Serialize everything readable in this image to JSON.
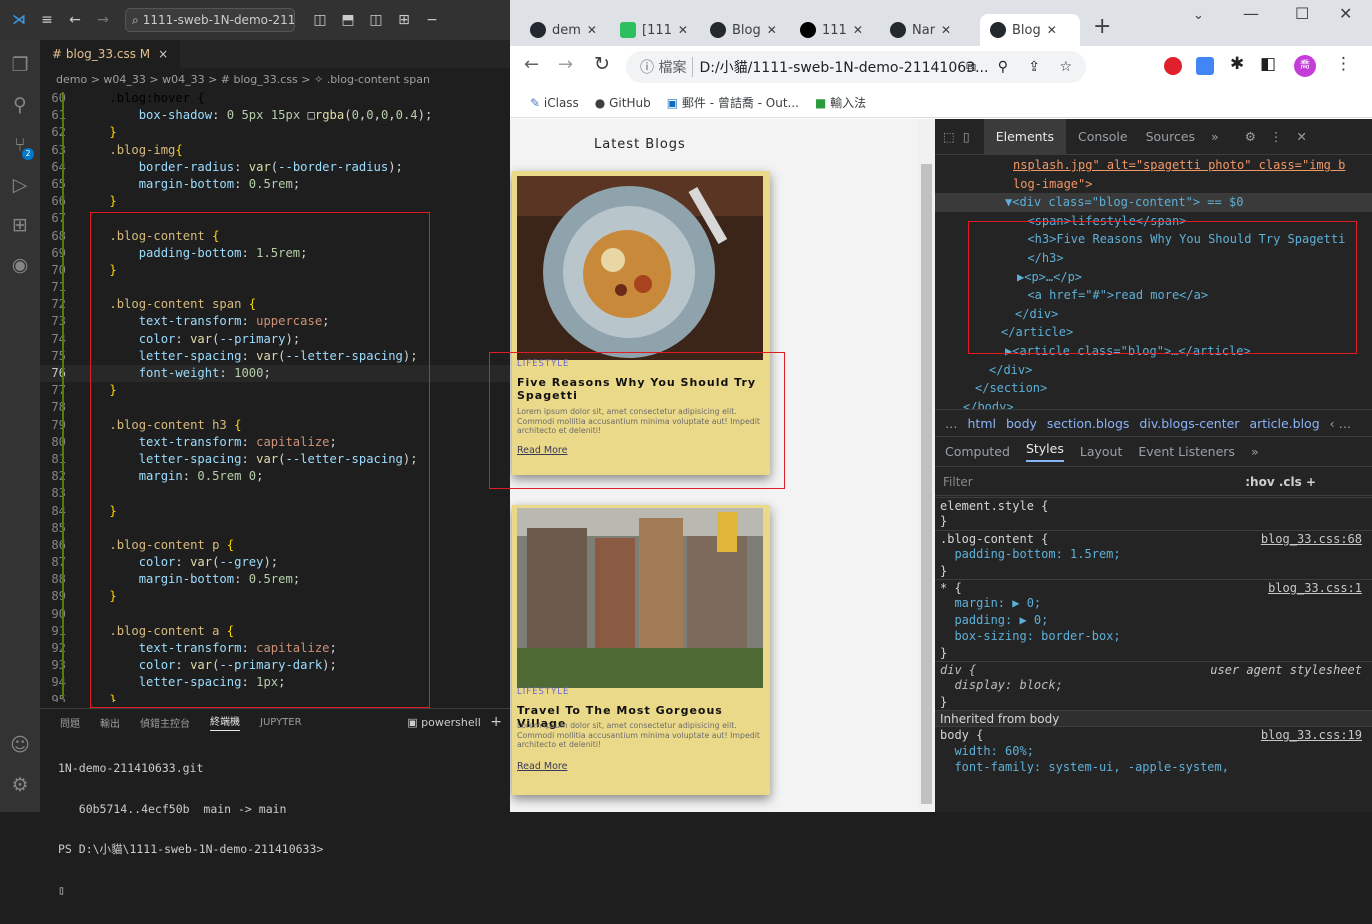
{
  "vscode": {
    "command_center": "1111-sweb-1N-demo-21141...",
    "tab": "# blog_33.css M",
    "breadcrumb": "demo > w04_33 > w04_33 > # blog_33.css > ✧ .blog-content span",
    "lines": [
      {
        "n": "60",
        "t": "    .blog:hover {"
      },
      {
        "n": "61",
        "t": "        box-shadow: 0 5px 15px □rgba(0,0,0,0.4);"
      },
      {
        "n": "62",
        "t": "    }"
      },
      {
        "n": "63",
        "t": "    .blog-img{"
      },
      {
        "n": "64",
        "t": "        border-radius: var(--border-radius);"
      },
      {
        "n": "65",
        "t": "        margin-bottom: 0.5rem;"
      },
      {
        "n": "66",
        "t": "    }"
      },
      {
        "n": "67",
        "t": ""
      },
      {
        "n": "68",
        "t": "    .blog-content {"
      },
      {
        "n": "69",
        "t": "        padding-bottom: 1.5rem;"
      },
      {
        "n": "70",
        "t": "    }"
      },
      {
        "n": "71",
        "t": ""
      },
      {
        "n": "72",
        "t": "    .blog-content span {"
      },
      {
        "n": "73",
        "t": "        text-transform: uppercase;"
      },
      {
        "n": "74",
        "t": "        color: var(--primary);"
      },
      {
        "n": "75",
        "t": "        letter-spacing: var(--letter-spacing);"
      },
      {
        "n": "76",
        "t": "        font-weight: 1000;"
      },
      {
        "n": "77",
        "t": "    }"
      },
      {
        "n": "78",
        "t": ""
      },
      {
        "n": "79",
        "t": "    .blog-content h3 {"
      },
      {
        "n": "80",
        "t": "        text-transform: capitalize;"
      },
      {
        "n": "81",
        "t": "        letter-spacing: var(--letter-spacing);"
      },
      {
        "n": "82",
        "t": "        margin: 0.5rem 0;"
      },
      {
        "n": "83",
        "t": ""
      },
      {
        "n": "84",
        "t": "    }"
      },
      {
        "n": "85",
        "t": ""
      },
      {
        "n": "86",
        "t": "    .blog-content p {"
      },
      {
        "n": "87",
        "t": "        color: var(--grey);"
      },
      {
        "n": "88",
        "t": "        margin-bottom: 0.5rem;"
      },
      {
        "n": "89",
        "t": "    }"
      },
      {
        "n": "90",
        "t": ""
      },
      {
        "n": "91",
        "t": "    .blog-content a {"
      },
      {
        "n": "92",
        "t": "        text-transform: capitalize;"
      },
      {
        "n": "93",
        "t": "        color: var(--primary-dark);"
      },
      {
        "n": "94",
        "t": "        letter-spacing: 1px;"
      },
      {
        "n": "95",
        "t": "    }"
      }
    ],
    "panel_tabs": [
      "問題",
      "輸出",
      "偵錯主控台",
      "終端機",
      "JUPYTER"
    ],
    "panel_active": "終端機",
    "shell": "powershell",
    "terminal": [
      "1N-demo-211410633.git",
      "   60b5714..4ecf50b  main -> main",
      "PS D:\\小貓\\1111-sweb-1N-demo-211410633>",
      "▯"
    ]
  },
  "browser": {
    "tabs": [
      {
        "label": "dem",
        "icon": "github-icon"
      },
      {
        "label": "[111",
        "icon": "evernote-icon"
      },
      {
        "label": "Blog",
        "icon": "chrome-icon"
      },
      {
        "label": "111",
        "icon": "vercel-icon"
      },
      {
        "label": "Nar",
        "icon": "github-icon"
      },
      {
        "label": "Blog",
        "icon": "chrome-icon",
        "active": true
      }
    ],
    "address_prefix": "ⓘ 檔案",
    "address": "D:/小貓/1111-sweb-1N-demo-21141063...",
    "bookmarks": [
      {
        "label": "iClass",
        "icon": "iclass-icon"
      },
      {
        "label": "GitHub",
        "icon": "github-icon"
      },
      {
        "label": "郵件 - 曾詰喬 - Out...",
        "icon": "outlook-icon"
      },
      {
        "label": "輸入法",
        "icon": "ime-icon"
      }
    ],
    "profile_initial": "喬"
  },
  "page": {
    "heading": "Latest Blogs",
    "posts": [
      {
        "tag": "lifestyle",
        "title": "Five Reasons Why You Should Try Spagetti",
        "text": "Lorem ipsum dolor sit, amet consectetur adipisicing elit. Commodi mollitia accusantium minima voluptate aut! Impedit architecto et deleniti!",
        "link": "Read More"
      },
      {
        "tag": "lifestyle",
        "title": "Travel To The Most Gorgeous Village",
        "text": "Lorem ipsum dolor sit, amet consectetur adipisicing elit. Commodi mollitia accusantium minima voluptate aut! Impedit architecto et deleniti!",
        "link": "Read More"
      }
    ]
  },
  "devtools": {
    "tabs": [
      "Elements",
      "Console",
      "Sources",
      "»"
    ],
    "active_tab": "Elements",
    "dom": [
      "nsplash.jpg\" alt=\"spagetti photo\" class=\"img b",
      "log-image\">",
      "▼<div class=\"blog-content\"> == $0",
      "  <span>lifestyle</span>",
      "  <h3>Five Reasons Why You Should Try Spagetti",
      "  </h3>",
      "▶<p>…</p>",
      "  <a href=\"#\">read more</a>",
      "</div>",
      "</article>",
      "▶<article class=\"blog\">…</article>",
      "</div>",
      "</section>",
      "</body>"
    ],
    "crumbs": [
      "…",
      "html",
      "body",
      "section.blogs",
      "div.blogs-center",
      "article.blog",
      "‹ …"
    ],
    "style_tabs": [
      "Computed",
      "Styles",
      "Layout",
      "Event Listeners",
      "»"
    ],
    "active_style_tab": "Styles",
    "filter_placeholder": "Filter",
    "filter_tools": ":hov .cls +",
    "rules": [
      {
        "t": "element.style {",
        "src": ""
      },
      {
        "t": "}",
        "src": ""
      },
      {
        "t": ".blog-content {",
        "src": "blog_33.css:68"
      },
      {
        "t": "  padding-bottom: 1.5rem;",
        "src": ""
      },
      {
        "t": "}",
        "src": ""
      },
      {
        "t": "* {",
        "src": "blog_33.css:1"
      },
      {
        "t": "  margin: ▶ 0;",
        "src": ""
      },
      {
        "t": "  padding: ▶ 0;",
        "src": ""
      },
      {
        "t": "  box-sizing: border-box;",
        "src": ""
      },
      {
        "t": "}",
        "src": ""
      },
      {
        "t": "div {",
        "src": "user agent stylesheet"
      },
      {
        "t": "  display: block;",
        "src": ""
      },
      {
        "t": "}",
        "src": ""
      },
      {
        "t": "Inherited from body",
        "src": ""
      },
      {
        "t": "body {",
        "src": "blog_33.css:19"
      },
      {
        "t": "  width: 60%;",
        "src": ""
      },
      {
        "t": "  font-family: system-ui, -apple-system,",
        "src": ""
      }
    ]
  }
}
